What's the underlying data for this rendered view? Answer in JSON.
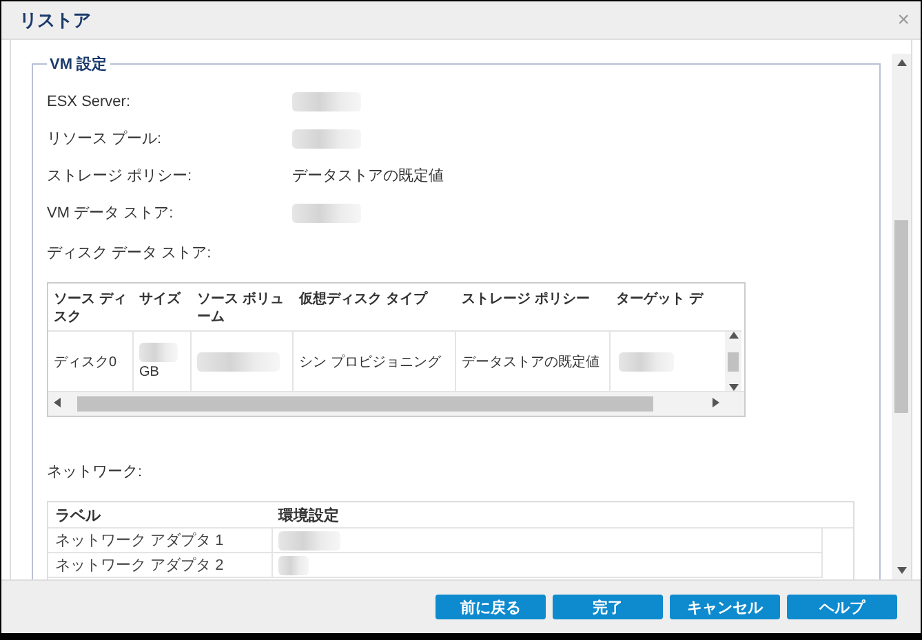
{
  "window": {
    "title": "リストア",
    "close": "×"
  },
  "vm_settings": {
    "legend": "VM 設定",
    "fields": [
      {
        "label": "ESX Server:",
        "kind": "redacted"
      },
      {
        "label": "リソース プール:",
        "kind": "redacted"
      },
      {
        "label": "ストレージ ポリシー:",
        "kind": "text",
        "value": "データストアの既定値"
      },
      {
        "label": "VM データ ストア:",
        "kind": "redacted"
      }
    ],
    "disk_label": "ディスク データ ストア:",
    "disk_table": {
      "columns": [
        "ソース ディスク",
        "サイズ",
        "ソース ボリューム",
        "仮想ディスク タイプ",
        "ストレージ ポリシー",
        "ターゲット デ"
      ],
      "rows": [
        {
          "cells": [
            {
              "kind": "text",
              "text": "ディスク0"
            },
            {
              "kind": "redacted_unit",
              "text": "GB"
            },
            {
              "kind": "redacted"
            },
            {
              "kind": "text",
              "text": "シン プロビジョニング"
            },
            {
              "kind": "text",
              "text": "データストアの既定値"
            },
            {
              "kind": "redacted"
            }
          ]
        }
      ]
    },
    "network_label": "ネットワーク:",
    "network_table": {
      "columns": [
        "ラベル",
        "環境設定"
      ],
      "rows": [
        {
          "label": "ネットワーク アダプタ 1",
          "kind": "redacted"
        },
        {
          "label": "ネットワーク アダプタ 2",
          "kind": "redacted"
        }
      ]
    }
  },
  "buttons": [
    "前に戻る",
    "完了",
    "キャンセル",
    "ヘルプ"
  ]
}
